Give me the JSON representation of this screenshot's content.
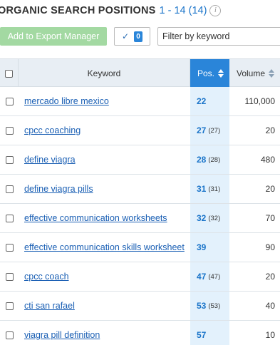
{
  "header": {
    "title": "ORGANIC SEARCH POSITIONS",
    "range": "1 - 14 (14)",
    "info_icon": "i"
  },
  "toolbar": {
    "export_label": "Add to Export Manager",
    "check_mark": "✓",
    "selected_count": "0",
    "filter_placeholder": "Filter by keyword"
  },
  "table": {
    "columns": {
      "keyword": "Keyword",
      "pos": "Pos.",
      "volume": "Volume"
    },
    "rows": [
      {
        "keyword": "mercado libre mexico",
        "pos": "22",
        "prev": "",
        "volume": "110,000"
      },
      {
        "keyword": "cpcc coaching",
        "pos": "27",
        "prev": "(27)",
        "volume": "20"
      },
      {
        "keyword": "define viagra",
        "pos": "28",
        "prev": "(28)",
        "volume": "480"
      },
      {
        "keyword": "define viagra pills",
        "pos": "31",
        "prev": "(31)",
        "volume": "20"
      },
      {
        "keyword": "effective communication worksheets",
        "pos": "32",
        "prev": "(32)",
        "volume": "70"
      },
      {
        "keyword": "effective communication skills worksheet",
        "pos": "39",
        "prev": "",
        "volume": "90"
      },
      {
        "keyword": "cpcc coach",
        "pos": "47",
        "prev": "(47)",
        "volume": "20"
      },
      {
        "keyword": "cti san rafael",
        "pos": "53",
        "prev": "(53)",
        "volume": "40"
      },
      {
        "keyword": "viagra pill definition",
        "pos": "57",
        "prev": "",
        "volume": "10"
      }
    ]
  }
}
